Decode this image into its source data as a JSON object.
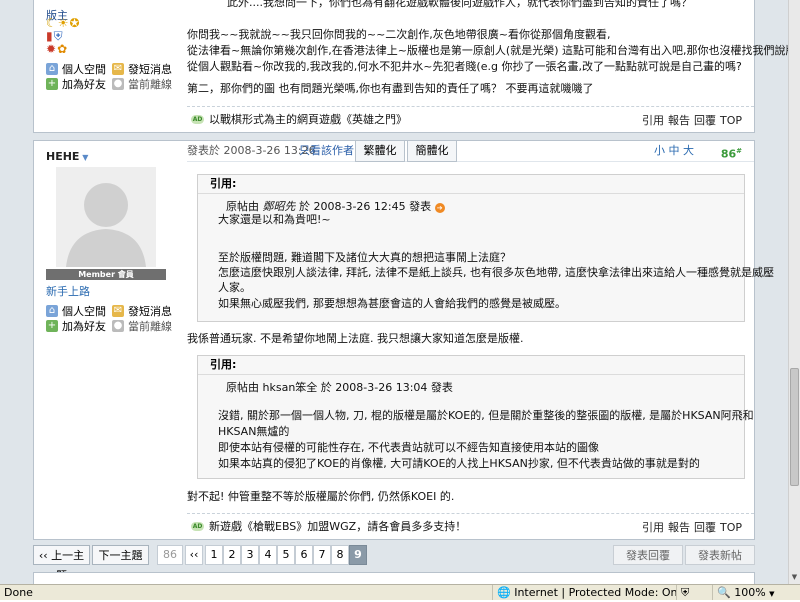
{
  "post1": {
    "rank_title": "版主",
    "user_links": [
      "個人空間",
      "發短消息",
      "加為好友",
      "當前離線"
    ],
    "top_line": "此外....我想問一下，你們也為有翻花遊戲軟體後向遊戲作人，就代表你們盡到告知的責任了嗎？",
    "body_lines": [
      "你問我~~我就說~~我只回你問我的~~二次創作,灰色地帶很廣~看你從那個角度觀看,",
      "從法律看~無論你第幾次創作,在香港法律上~版權也是第一原創人(就是光榮) 這點可能和台灣有出入吧,那你也沒權找我們說版權吧",
      "從個人觀點看~你改我的,我改我的,何水不犯井水~先犯者賤(e.g 你抄了一張名畫,改了一點點就可說是自己畫的嗎?"
    ],
    "second_line": "第二，那你們的圖 也有問題光榮嗎,你也有盡到告知的責任了嗎？ 不要再這就嘰嘰了",
    "signature": "以戰棋形式為主的網頁遊戲《英雄之門》",
    "actions": [
      "引用",
      "報告",
      "回覆",
      "TOP"
    ]
  },
  "post2": {
    "username": "HEHE",
    "rank": "新手上路",
    "member_badge": "Member 會員",
    "user_links": [
      "個人空間",
      "發短消息",
      "加為好友",
      "當前離線"
    ],
    "posted": "發表於 2008-3-26 13:26",
    "only_author": "只看該作者",
    "tab_trad": "繁體化",
    "tab_simp": "簡體化",
    "font_sizes": [
      "小",
      "中",
      "大"
    ],
    "floor": "86",
    "floor_suffix": "#",
    "quote1": {
      "header": "引用:",
      "author_prefix": "原帖由",
      "author": "鄭昭先",
      "author_suffix": "於 2008-3-26 12:45 發表",
      "lines": [
        "大家還是以和為貴吧!~",
        "",
        "至於版權問題, 難道閣下及諸位大大真的想把這事鬧上法庭？",
        "怎麼這麼快跟別人談法律, 拜託, 法律不是紙上談兵, 也有很多灰色地帶, 這麼快拿法律出來這給人一種感覺就是威壓",
        "人家。",
        "如果無心威壓我們, 那要想想為甚麼會這的人會給我們的感覺是被威壓。"
      ]
    },
    "reply1": "我係普通玩家. 不是希望你地鬧上法庭. 我只想讓大家知道怎麼是版權.",
    "quote2": {
      "header": "引用:",
      "author_prefix": "原帖由",
      "author": "hksan笨全",
      "author_suffix": "於 2008-3-26 13:04 發表",
      "lines": [
        "沒錯, 關於那一個一個人物, 刀, 棍的版權是屬於KOE的, 但是關於重整後的整張圖的版權, 是屬於HKSAN阿飛和",
        "HKSAN無爐的",
        "即使本站有侵權的可能性存在, 不代表貴站就可以不經告知直接使用本站的圖像",
        "如果本站真的侵犯了KOE的肖像權, 大可請KOE的人找上HKSAN抄家, 但不代表貴站做的事就是對的"
      ]
    },
    "reply2": "對不起! 仲管重整不等於版權屬於你們, 仍然係KOEI 的.",
    "signature": "新遊戲《槍戰EBS》加盟WGZ，請各會員多多支持！",
    "actions": [
      "引用",
      "報告",
      "回覆",
      "TOP"
    ]
  },
  "pager": {
    "prev": "‹‹ 上一主題",
    "next": "下一主題 ››",
    "pages": [
      "86",
      "‹‹",
      "1",
      "2",
      "3",
      "4",
      "5",
      "6",
      "7",
      "8",
      "9"
    ],
    "current": "9",
    "reply_btn": "發表回覆",
    "new_btn": "發表新帖"
  },
  "status": {
    "left": "Done",
    "zone": "Internet | Protected Mode: On",
    "zoom": "100%"
  }
}
